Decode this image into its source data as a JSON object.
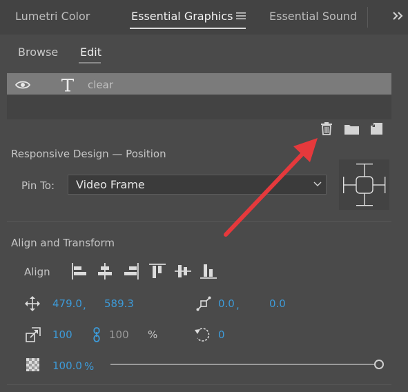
{
  "top_tabs": [
    {
      "label": "Lumetri Color"
    },
    {
      "label": "Essential Graphics",
      "active": true
    },
    {
      "label": "Essential Sound"
    }
  ],
  "sub_tabs": [
    {
      "label": "Browse"
    },
    {
      "label": "Edit",
      "active": true
    }
  ],
  "layers": [
    {
      "name": "clear",
      "type": "text"
    }
  ],
  "layer_actions": [
    "trash-icon",
    "folder-icon",
    "new-layer-icon"
  ],
  "responsive": {
    "title": "Responsive Design — Position",
    "pin_label": "Pin To:",
    "pin_value": "Video Frame"
  },
  "align_transform": {
    "title": "Align and Transform",
    "align_label": "Align",
    "position_x": "479.0",
    "position_y": "589.3",
    "anchor_x": "0.0",
    "anchor_y": "0.0",
    "scale_w": "100",
    "scale_h": "100",
    "scale_unit": "%",
    "rotation": "0",
    "opacity": "100.0",
    "opacity_unit": "%",
    "comma": ","
  },
  "annotation": {
    "color": "#e5393c"
  },
  "colors": {
    "accent": "#3d9bd9",
    "panel": "#4a4a4a",
    "selected_row": "#7b7b7b"
  }
}
